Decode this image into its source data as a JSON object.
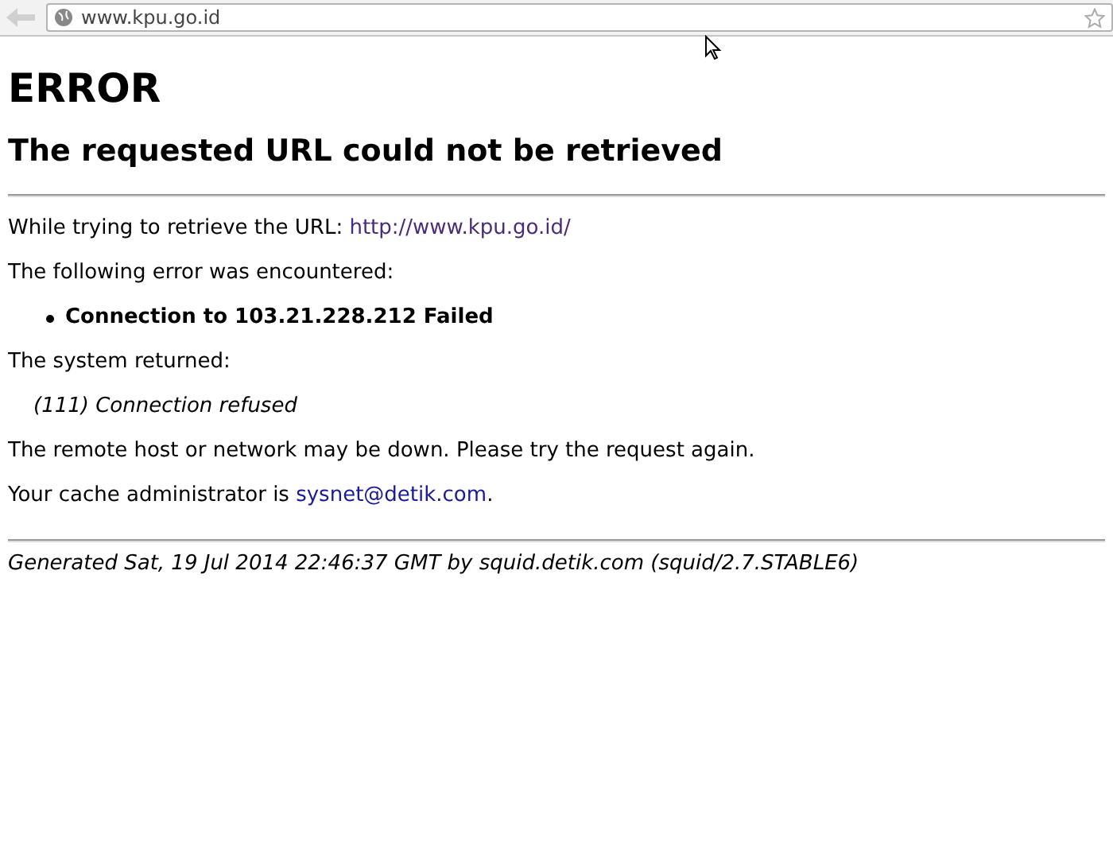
{
  "address_bar": {
    "url": "www.kpu.go.id"
  },
  "page": {
    "title": "ERROR",
    "subtitle": "The requested URL could not be retrieved",
    "url_line": {
      "text": "While trying to retrieve the URL: ",
      "link": "http://www.kpu.go.id/"
    },
    "error_intro": "The following error was encountered:",
    "errors": [
      "Connection to 103.21.228.212 Failed"
    ],
    "system_intro": "The system returned:",
    "system_message": "(111) Connection refused",
    "advice": "The remote host or network may be down. Please try the request again.",
    "admin_line": {
      "text": "Your cache administrator is ",
      "link": "sysnet@detik.com",
      "after": "."
    },
    "footer": "Generated Sat, 19 Jul 2014 22:46:37 GMT by squid.detik.com (squid/2.7.STABLE6)"
  }
}
